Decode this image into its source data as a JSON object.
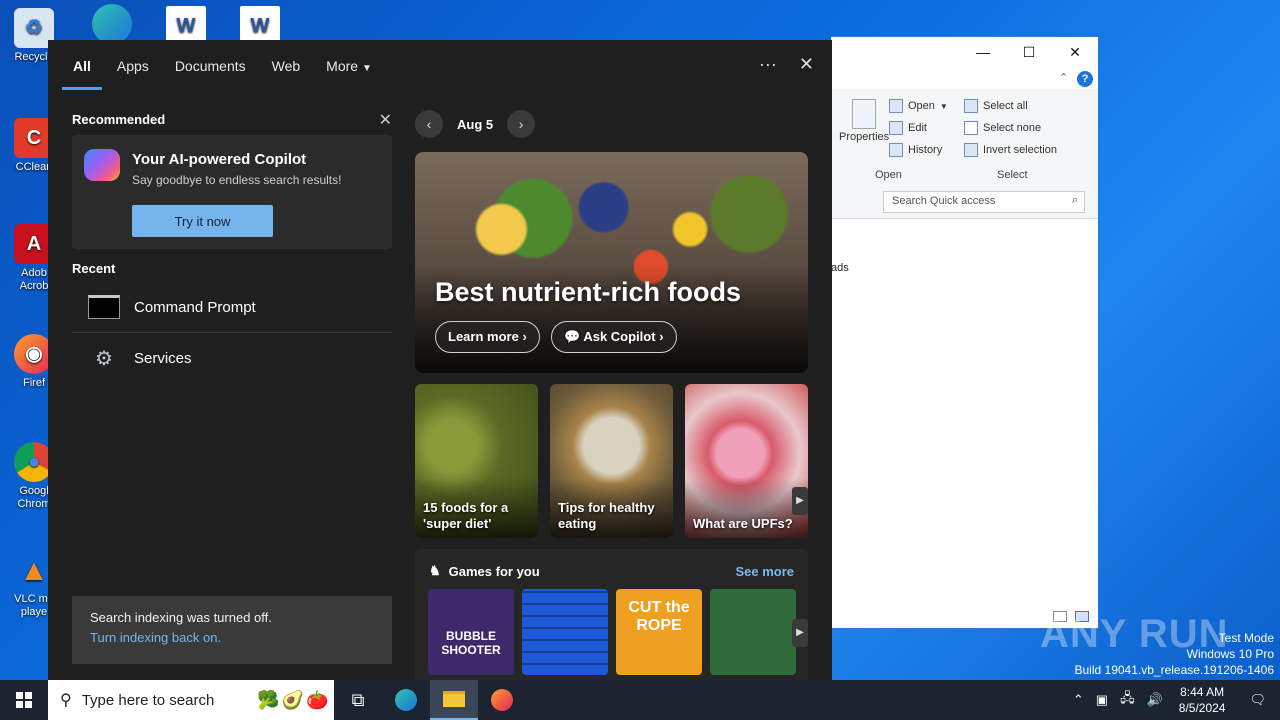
{
  "desktop": {
    "icons": [
      {
        "label": "Recycle"
      },
      {
        "label": "CClean"
      },
      {
        "label": "Adob Acrob"
      },
      {
        "label": "Firef"
      },
      {
        "label": "Googl Chrom"
      },
      {
        "label": "VLC me playe"
      }
    ]
  },
  "explorer": {
    "ribbon": {
      "properties": "Properties",
      "open": "Open",
      "edit": "Edit",
      "history": "History",
      "open_group": "Open",
      "select_all": "Select all",
      "select_none": "Select none",
      "invert_selection": "Invert selection",
      "select_group": "Select"
    },
    "search_placeholder": "Search Quick access",
    "partial_item": "ads"
  },
  "search_panel": {
    "tabs": [
      "All",
      "Apps",
      "Documents",
      "Web",
      "More"
    ],
    "recommended": {
      "title": "Recommended",
      "card_title": "Your AI-powered Copilot",
      "card_subtitle": "Say goodbye to endless search results!",
      "button": "Try it now"
    },
    "recent": {
      "title": "Recent",
      "items": [
        "Command Prompt",
        "Services"
      ]
    },
    "indexing": {
      "message": "Search indexing was turned off.",
      "link": "Turn indexing back on."
    },
    "date": "Aug 5",
    "hero": {
      "title": "Best nutrient-rich foods",
      "learn_more": "Learn more",
      "ask_copilot": "Ask Copilot"
    },
    "thumbs": [
      {
        "caption": "15 foods for a 'super diet'"
      },
      {
        "caption": "Tips for healthy eating"
      },
      {
        "caption": "What are UPFs?"
      }
    ],
    "games": {
      "title": "Games for you",
      "see_more": "See more",
      "items": [
        "BUBBLE SHOOTER",
        "",
        "CUT the ROPE",
        ""
      ]
    }
  },
  "taskbar": {
    "search_placeholder": "Type here to search",
    "time": "8:44 AM",
    "date": "8/5/2024"
  },
  "overlay": {
    "watermark": "ANY RUN",
    "test_mode": "Test Mode",
    "os": "Windows 10 Pro",
    "build": "Build 19041.vb_release.191206-1406"
  }
}
